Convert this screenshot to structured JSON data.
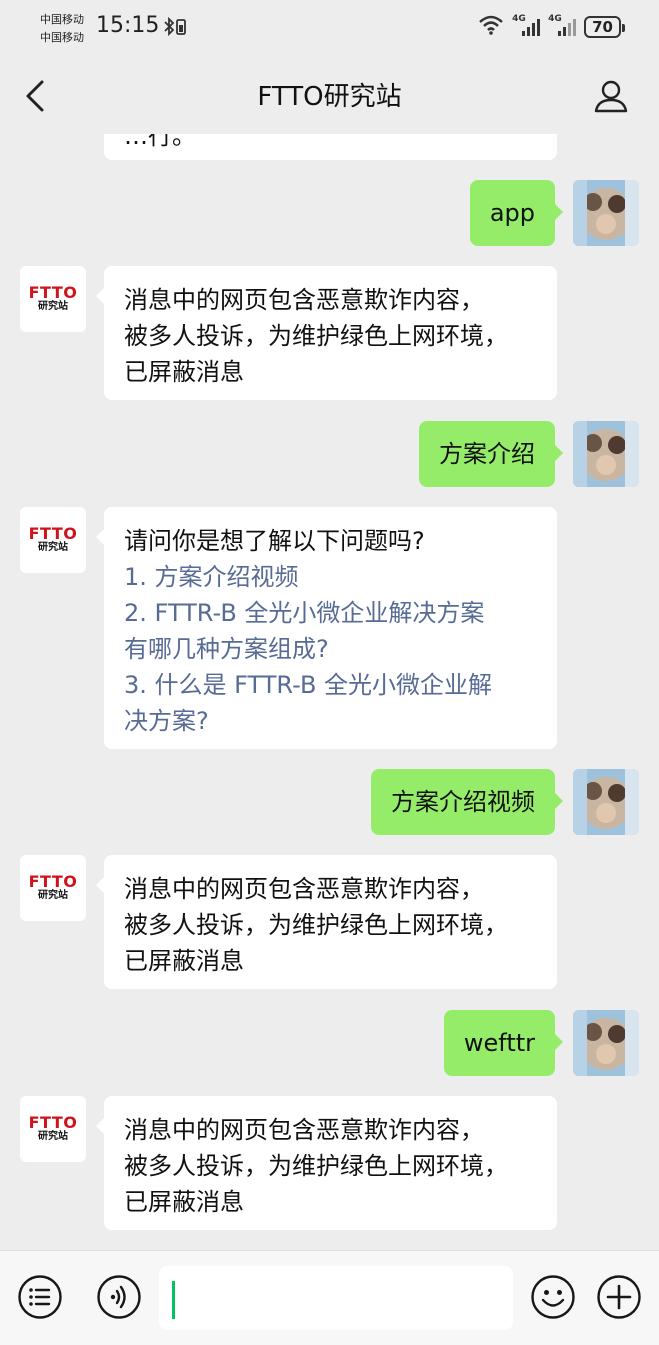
{
  "status_bar": {
    "carrier_1": "中国移动",
    "carrier_2": "中国移动",
    "time": "15:15",
    "network_1": "4G",
    "network_2": "4G",
    "battery": "70"
  },
  "header": {
    "title": "FTTO研究站"
  },
  "bot": {
    "logo_line1": "FTTO",
    "logo_line2": "研究站"
  },
  "messages": [
    {
      "from": "bot",
      "lines": [
        "…行。"
      ]
    },
    {
      "from": "user",
      "text": "app"
    },
    {
      "from": "bot",
      "lines": [
        "消息中的网页包含恶意欺诈内容，",
        "被多人投诉，为维护绿色上网环境，",
        "已屏蔽消息"
      ]
    },
    {
      "from": "user",
      "text": "方案介绍"
    },
    {
      "from": "bot",
      "intro": "请问你是想了解以下问题吗?",
      "options": [
        "1. 方案介绍视频",
        "2. FTTR-B 全光小微企业解决方案",
        "有哪几种方案组成?",
        "3. 什么是 FTTR-B 全光小微企业解",
        "决方案?"
      ]
    },
    {
      "from": "user",
      "text": "方案介绍视频"
    },
    {
      "from": "bot",
      "lines": [
        "消息中的网页包含恶意欺诈内容，",
        "被多人投诉，为维护绿色上网环境，",
        "已屏蔽消息"
      ]
    },
    {
      "from": "user",
      "text": "wefttr"
    },
    {
      "from": "bot",
      "lines": [
        "消息中的网页包含恶意欺诈内容，",
        "被多人投诉，为维护绿色上网环境，",
        "已屏蔽消息"
      ]
    }
  ],
  "input": {
    "value": ""
  },
  "colors": {
    "user_bubble": "#95ec69",
    "link": "#576b95",
    "logo_red": "#d0121b",
    "cursor": "#07c160"
  }
}
